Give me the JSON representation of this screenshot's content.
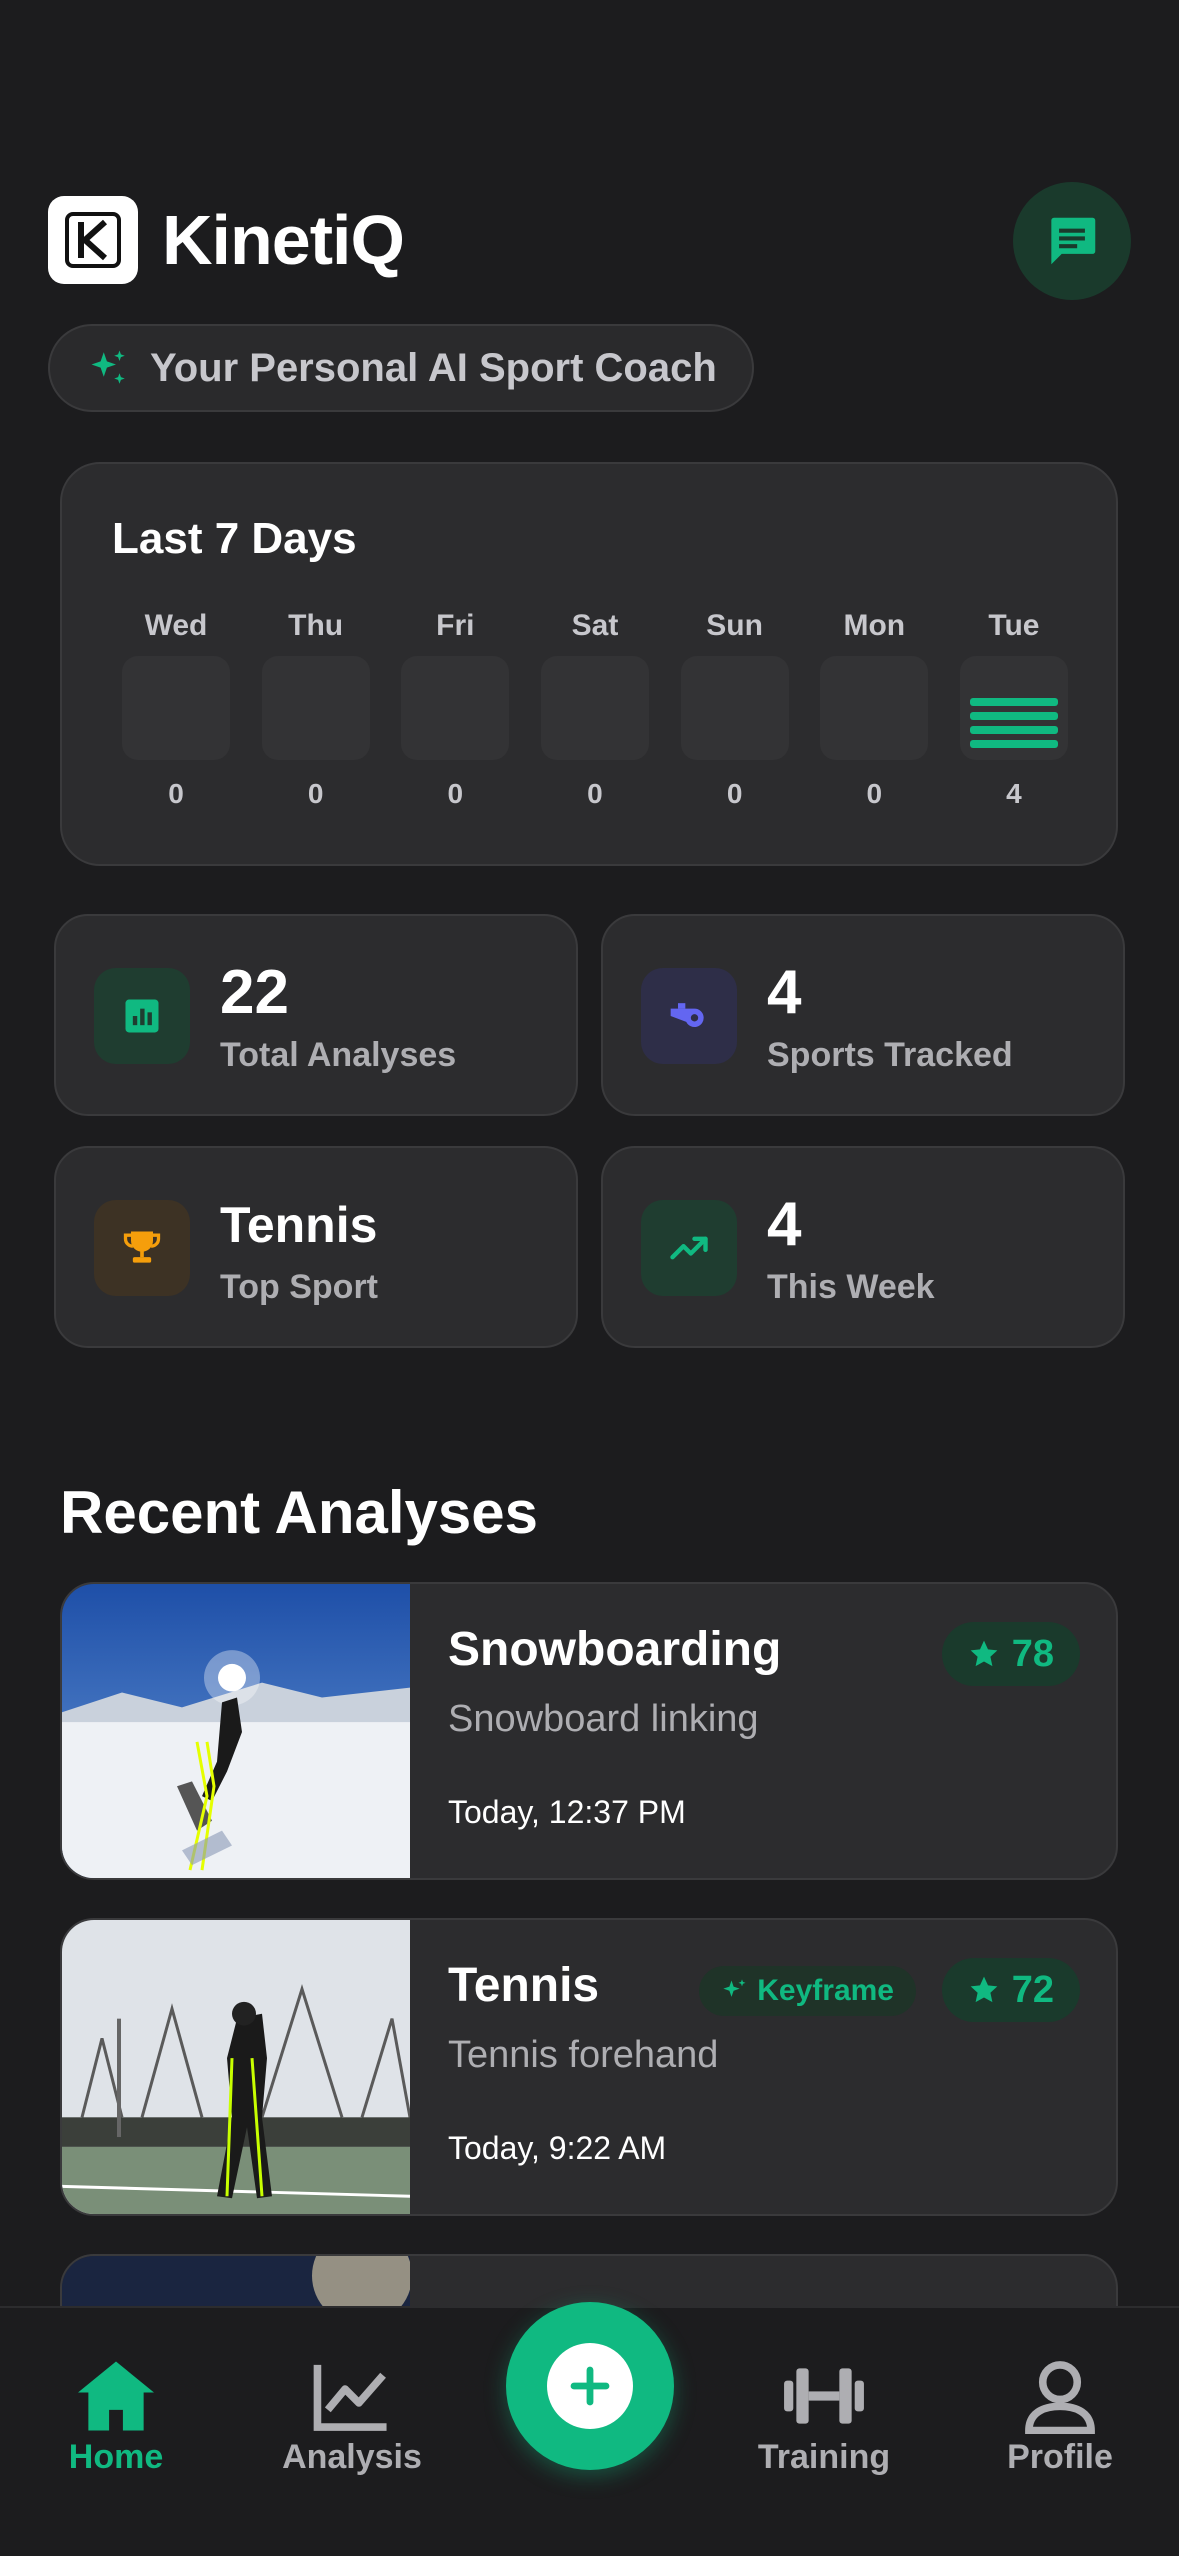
{
  "app": {
    "title": "KinetiQ",
    "tagline": "Your Personal AI Sport Coach"
  },
  "week": {
    "title": "Last 7 Days",
    "days": [
      {
        "name": "Wed",
        "count": "0"
      },
      {
        "name": "Thu",
        "count": "0"
      },
      {
        "name": "Fri",
        "count": "0"
      },
      {
        "name": "Sat",
        "count": "0"
      },
      {
        "name": "Sun",
        "count": "0"
      },
      {
        "name": "Mon",
        "count": "0"
      },
      {
        "name": "Tue",
        "count": "4"
      }
    ]
  },
  "stats": [
    {
      "value": "22",
      "label": "Total Analyses",
      "icon": "bar-chart-icon"
    },
    {
      "value": "4",
      "label": "Sports Tracked",
      "icon": "whistle-icon"
    },
    {
      "value": "Tennis",
      "label": "Top Sport",
      "icon": "trophy-icon"
    },
    {
      "value": "4",
      "label": "This Week",
      "icon": "trending-up-icon"
    }
  ],
  "recent": {
    "title": "Recent Analyses",
    "items": [
      {
        "sport": "Snowboarding",
        "description": "Snowboard linking",
        "time": "Today, 12:37 PM",
        "score": "78",
        "badge": ""
      },
      {
        "sport": "Tennis",
        "description": "Tennis forehand",
        "time": "Today, 9:22 AM",
        "score": "72",
        "badge": "Keyframe"
      }
    ]
  },
  "nav": {
    "home": "Home",
    "analysis": "Analysis",
    "training": "Training",
    "profile": "Profile"
  },
  "colors": {
    "accent": "#10b981",
    "background": "#1c1c1e",
    "card": "#2c2c2e"
  }
}
